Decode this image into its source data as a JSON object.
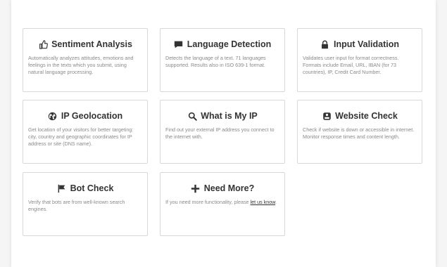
{
  "cards": [
    {
      "title": "Sentiment Analysis",
      "icon": "thumbs-up-icon",
      "desc": "Automatically analyzes attitudes, emotions and feelings in the texts which you submit, using natural language processing."
    },
    {
      "title": "Language Detection",
      "icon": "comment-icon",
      "desc": "Detects the language of a text. 71 languages supported. Results also in ISO 639-1 format."
    },
    {
      "title": "Input Validation",
      "icon": "lock-icon",
      "desc": "Validates user input for format correctness. Formats include Email, URL, IBAN (for 73 countries), IP, Credit Card Number."
    },
    {
      "title": "IP Geolocation",
      "icon": "globe-icon",
      "desc": "Get location of your visitors for better targeting: city, country and geographic coordinates for IP address or site (DNS name)."
    },
    {
      "title": "What is My IP",
      "icon": "search-icon",
      "desc": "Find out your external IP address you connect to the internet with."
    },
    {
      "title": "Website Check",
      "icon": "hdd-icon",
      "desc": "Check if website is down or accessible in internet. Monitor response times and content length."
    },
    {
      "title": "Bot Check",
      "icon": "flag-icon",
      "desc": "Verify that bots are from well-known search engines."
    },
    {
      "title": "Need More?",
      "icon": "plus-icon",
      "desc": "If you need more functionality, please ",
      "link": "let us know",
      "desc_end": "."
    }
  ]
}
